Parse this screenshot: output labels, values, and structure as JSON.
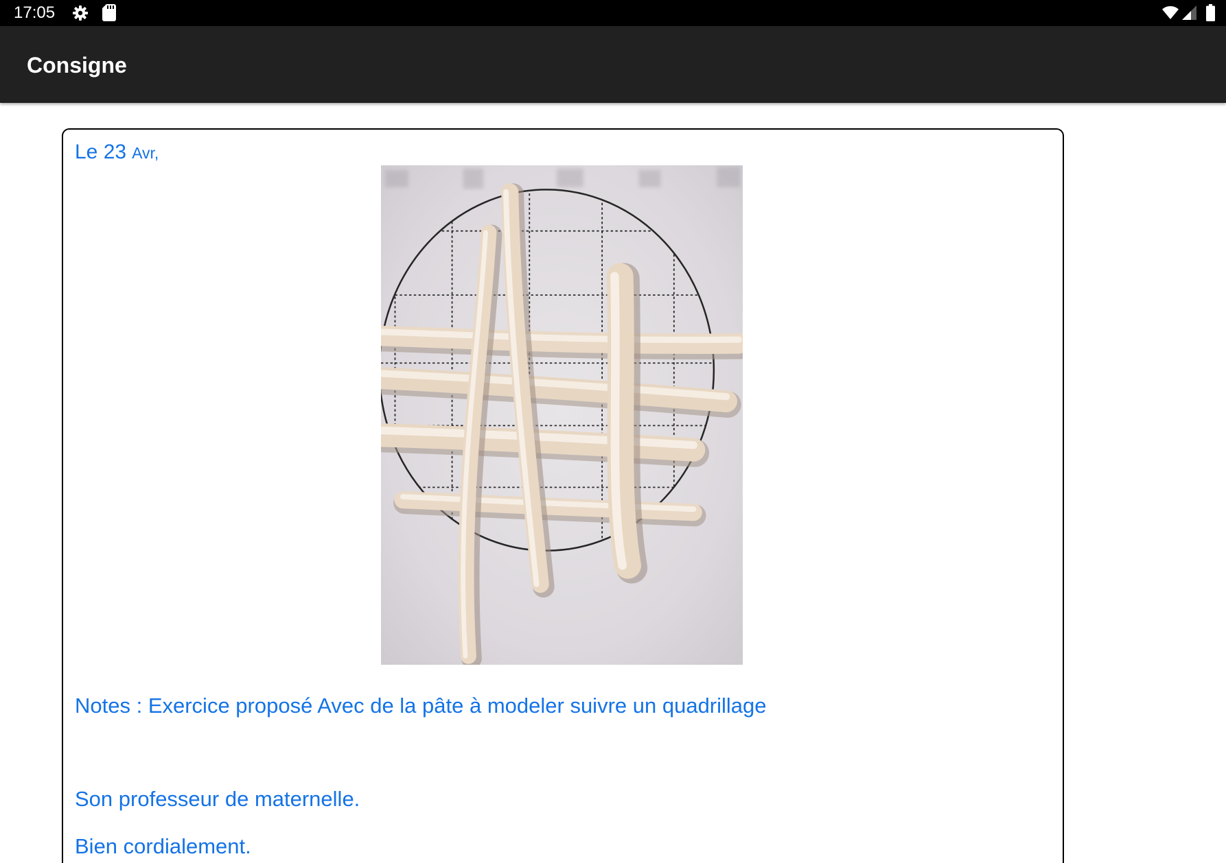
{
  "status_bar": {
    "time": "17:05",
    "icons_left": [
      "settings-icon",
      "sd-card-icon"
    ],
    "icons_right": [
      "wifi-icon",
      "signal-icon",
      "battery-icon"
    ]
  },
  "app_bar": {
    "title": "Consigne"
  },
  "message_card": {
    "date_day": "Le 23",
    "date_month": "Avr,",
    "notes": "Notes : Exercice proposé Avec de la pâte à modeler suivre un quadrillage",
    "signature": "Son professeur de maternelle.",
    "closing": "Bien cordialement."
  },
  "colors": {
    "status_bar": "#000000",
    "app_bar": "#212121",
    "app_bar_text": "#ffffff",
    "accent_text": "#1473e6",
    "card_border": "#000000",
    "background": "#ffffff"
  }
}
